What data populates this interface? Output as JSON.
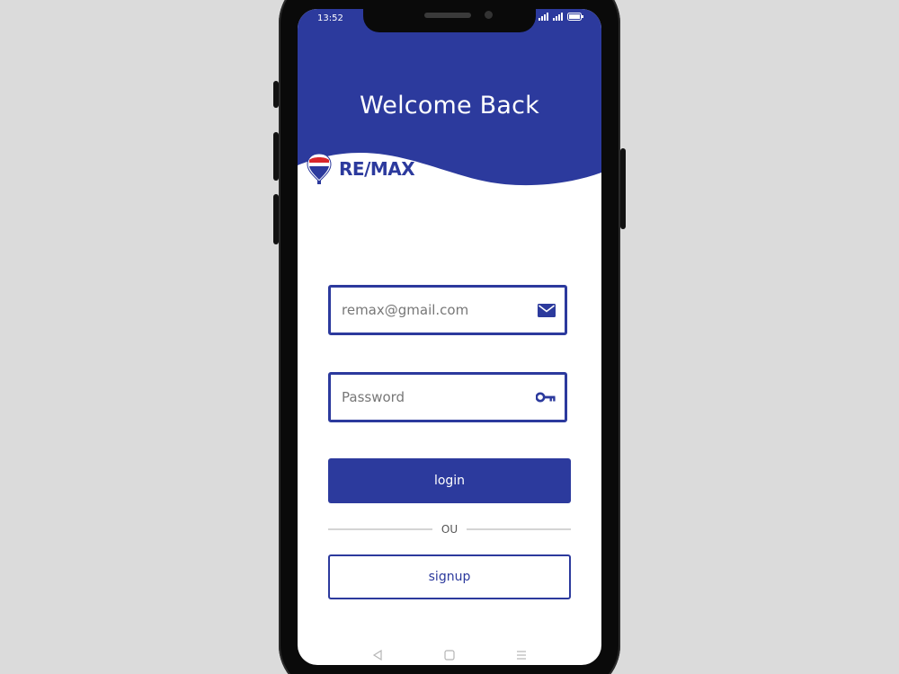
{
  "status_bar": {
    "time": "13:52",
    "icons": [
      "signal-icon",
      "signal-icon",
      "battery-icon"
    ]
  },
  "header": {
    "title": "Welcome Back",
    "color": "#2c3a9d"
  },
  "logo": {
    "text": "RE/MAX",
    "icon": "balloon-logo-icon"
  },
  "form": {
    "email": {
      "value": "remax@gmail.com",
      "icon": "envelope-icon"
    },
    "password": {
      "placeholder": "Password",
      "icon": "key-icon"
    },
    "login_label": "login",
    "divider_label": "OU",
    "signup_label": "signup"
  },
  "navigation": {
    "buttons": [
      "back-icon",
      "home-icon",
      "menu-icon"
    ]
  },
  "colors": {
    "accent": "#2c3a9d",
    "background": "#dbdbdb"
  }
}
